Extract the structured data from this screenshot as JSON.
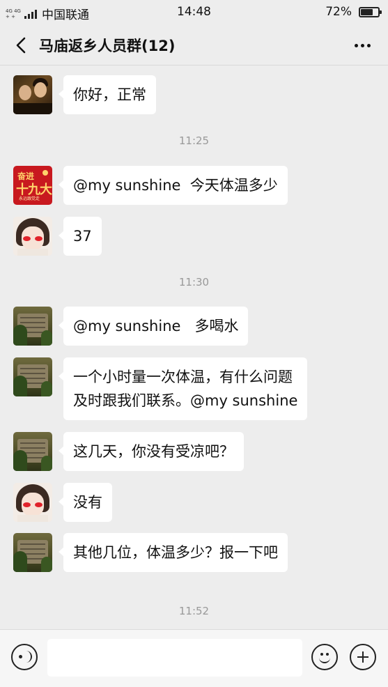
{
  "status_bar": {
    "network_top": "4G 4G",
    "network_bottom": "+ +",
    "carrier": "中国联通",
    "time": "14:48",
    "battery": "72%",
    "battery_level": 0.72
  },
  "header": {
    "back_icon": "chevron-left-icon",
    "title": "马庙返乡人员群(12)",
    "more_icon": "more-dots-icon"
  },
  "messages": [
    {
      "type": "message",
      "avatar": "avatar-couple",
      "text": "你好，正常"
    },
    {
      "type": "timestamp",
      "text": "11:25"
    },
    {
      "type": "message",
      "avatar": "avatar-red-poster",
      "text": "@my sunshine  今天体温多少"
    },
    {
      "type": "message",
      "avatar": "avatar-girl",
      "text": "37"
    },
    {
      "type": "timestamp",
      "text": "11:30"
    },
    {
      "type": "message",
      "avatar": "avatar-building",
      "text": "@my sunshine   多喝水"
    },
    {
      "type": "message",
      "avatar": "avatar-building",
      "text_lines": [
        "一个小时量一次体温，有什么问题",
        "及时跟我们联系。@my sunshine"
      ]
    },
    {
      "type": "message",
      "avatar": "avatar-building",
      "text": "这几天，你没有受凉吧？"
    },
    {
      "type": "message",
      "avatar": "avatar-girl",
      "text": "没有"
    },
    {
      "type": "message",
      "avatar": "avatar-building",
      "text": "其他几位，体温多少？报一下吧"
    },
    {
      "type": "timestamp",
      "text": "11:52"
    }
  ],
  "avatar_art": {
    "red_poster_line1": "奋进",
    "red_poster_line2": "十九大",
    "red_poster_line3": "永远跟党走"
  },
  "input_bar": {
    "voice_icon": "voice-icon",
    "input_value": "",
    "input_placeholder": "",
    "emoji_icon": "emoji-icon",
    "plus_icon": "plus-icon"
  }
}
